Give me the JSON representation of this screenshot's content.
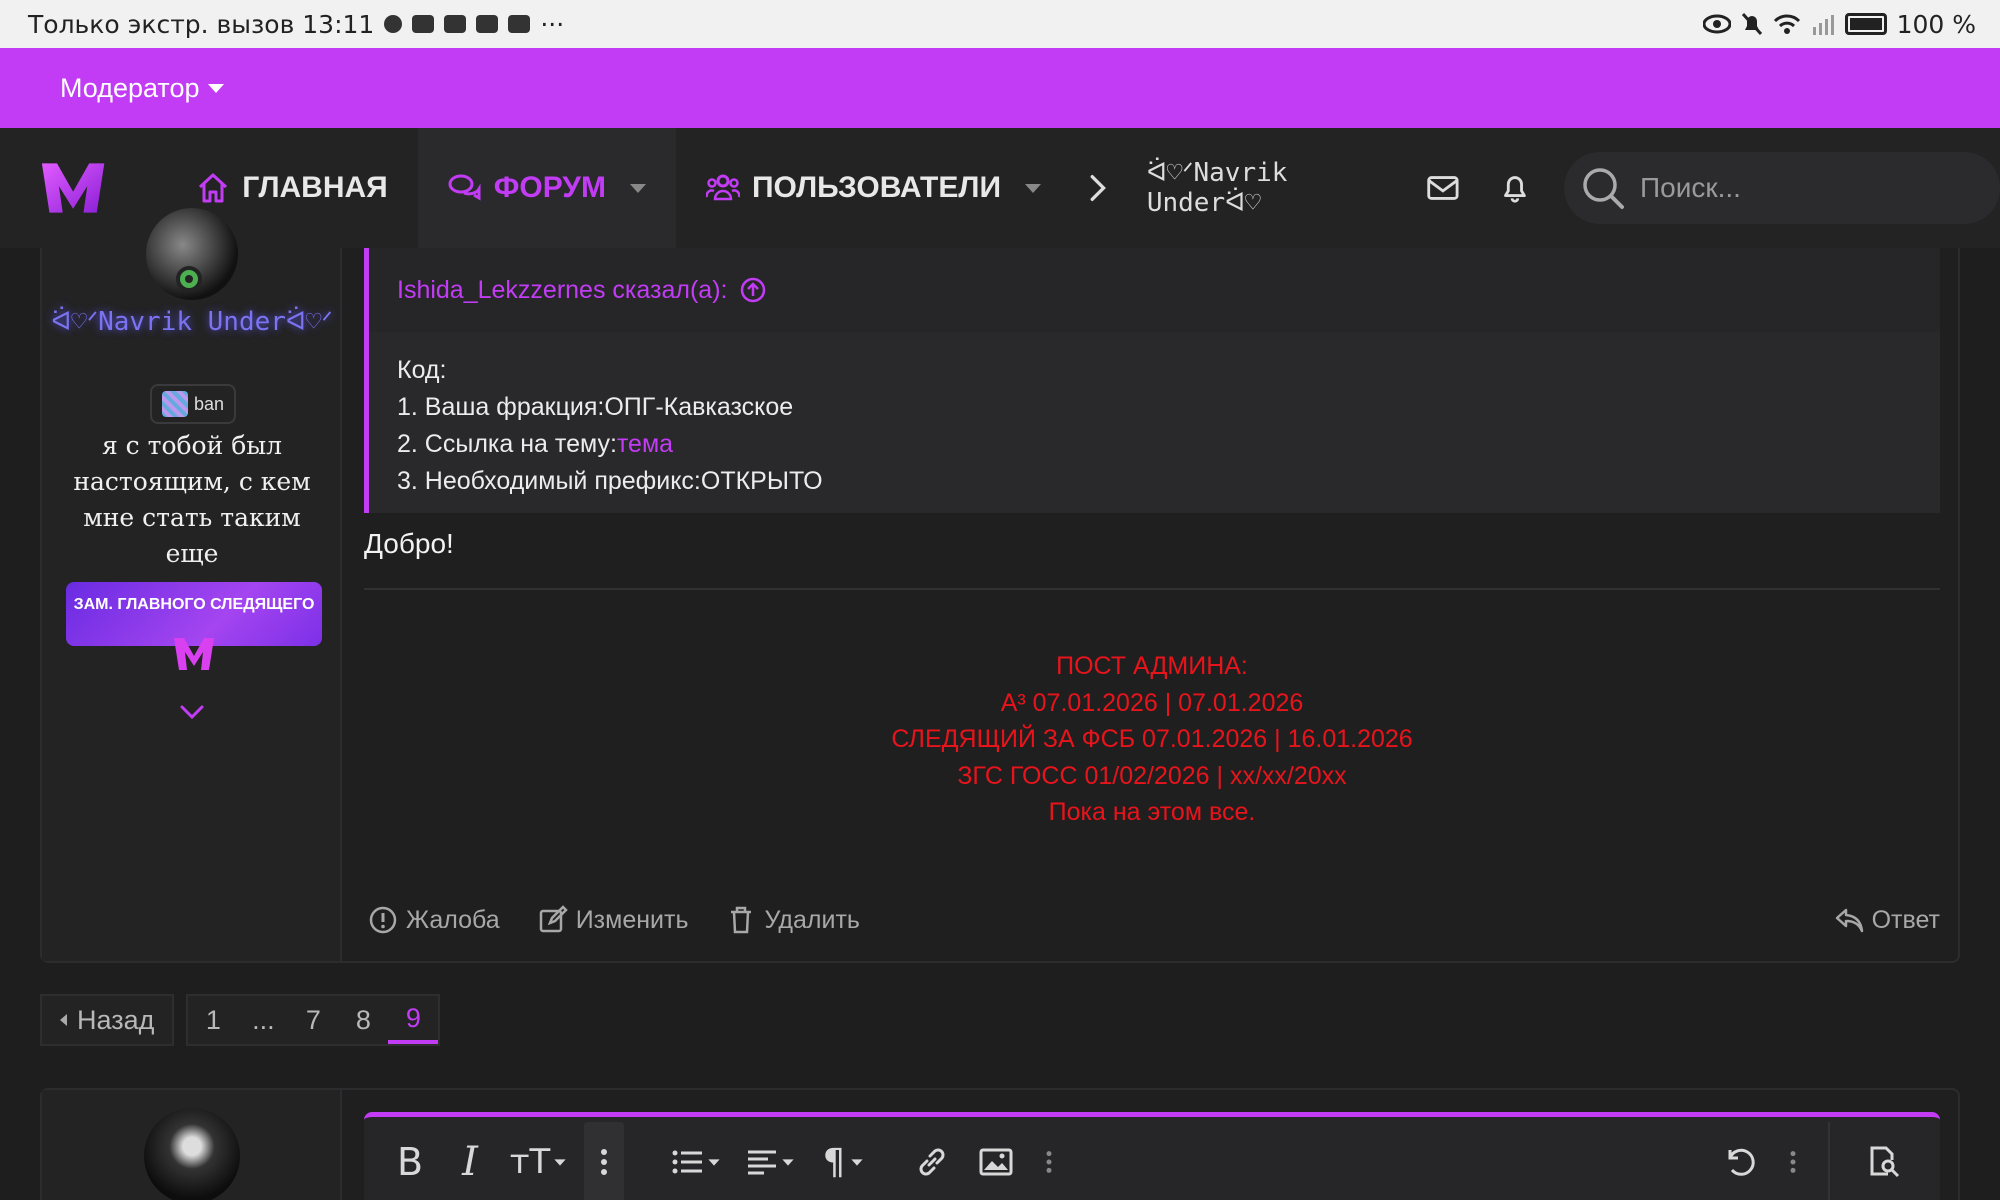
{
  "status_bar": {
    "left_text": "Только экстр. вызов 13:11",
    "right_text": "100 %"
  },
  "moderator": {
    "label": "Модератор"
  },
  "nav": {
    "home": "ГЛАВНАЯ",
    "forum": "ФОРУМ",
    "users": "ПОЛЬЗОВАТЕЛИ",
    "current_user": "ᐛ♡ᐟNavrik Underᐛ♡",
    "search_placeholder": "Поиск...",
    "accent": "#c23cf5"
  },
  "post": {
    "author": {
      "name": "ᐛ♡ᐟNavrik Underᐛ♡ᐟ",
      "badge": "ban",
      "status": "я с тобой был настоящим, с кем мне стать таким еще",
      "role_banner": "ЗАМ. ГЛАВНОГО СЛЕДЯЩЕГО"
    },
    "quote": {
      "header": "Ishida_Lekzzernes сказал(а):",
      "line1": "Код:",
      "line2": "1. Ваша фракция:ОПГ-Кавказское",
      "line3_prefix": "2. Ссылка на тему:",
      "line3_link": "тема",
      "line4": "3. Необходимый префикс:ОТКРЫТО"
    },
    "message": "Добро!",
    "signature": {
      "color": "#e8141b",
      "lines": [
        "ПОСТ АДМИНА:",
        "А³ 07.01.2026 | 07.01.2026",
        "СЛЕДЯЩИЙ ЗА ФСБ 07.01.2026 | 16.01.2026",
        "ЗГС ГОСС 01/02/2026 | xx/xx/20xx",
        "Пока на этом все."
      ]
    },
    "actions": {
      "report": "Жалоба",
      "edit": "Изменить",
      "delete": "Удалить",
      "reply": "Ответ"
    }
  },
  "pagination": {
    "prev": "Назад",
    "pages": [
      "1",
      "...",
      "7",
      "8",
      "9"
    ],
    "current": "9"
  }
}
